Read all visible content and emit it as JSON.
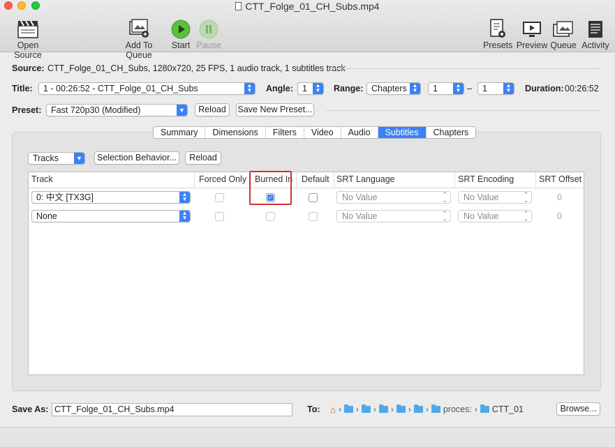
{
  "window": {
    "title": "CTT_Folge_01_CH_Subs.mp4"
  },
  "toolbar": {
    "open_source": "Open Source",
    "add_to_queue": "Add To Queue",
    "start": "Start",
    "pause": "Pause",
    "presets": "Presets",
    "preview": "Preview",
    "queue": "Queue",
    "activity": "Activity"
  },
  "source": {
    "label": "Source:",
    "value": "CTT_Folge_01_CH_Subs, 1280x720, 25 FPS, 1 audio track, 1 subtitles track"
  },
  "title_row": {
    "title_label": "Title:",
    "title_value": "1 - 00:26:52 - CTT_Folge_01_CH_Subs",
    "angle_label": "Angle:",
    "angle_value": "1",
    "range_label": "Range:",
    "range_type": "Chapters",
    "range_start": "1",
    "range_dash": "–",
    "range_end": "1",
    "duration_label": "Duration:",
    "duration_value": "00:26:52"
  },
  "preset_row": {
    "label": "Preset:",
    "value": "Fast 720p30 (Modified)",
    "reload": "Reload",
    "save_new": "Save New Preset..."
  },
  "tabs": [
    "Summary",
    "Dimensions",
    "Filters",
    "Video",
    "Audio",
    "Subtitles",
    "Chapters"
  ],
  "active_tab": "Subtitles",
  "subtitles": {
    "tracks_popup": "Tracks",
    "selection_behavior": "Selection Behavior...",
    "reload": "Reload",
    "columns": {
      "track": "Track",
      "forced_only": "Forced Only",
      "burned_in": "Burned In",
      "default": "Default",
      "srt_language": "SRT Language",
      "srt_encoding": "SRT Encoding",
      "srt_offset": "SRT Offset"
    },
    "rows": [
      {
        "track": "0: 中文 [TX3G]",
        "forced_only": false,
        "burned_in": true,
        "default": false,
        "srt_language": "No Value",
        "srt_encoding": "No Value",
        "srt_offset": "0"
      },
      {
        "track": "None",
        "forced_only": false,
        "burned_in": false,
        "default": false,
        "srt_language": "No Value",
        "srt_encoding": "No Value",
        "srt_offset": "0"
      }
    ]
  },
  "save": {
    "label": "Save As:",
    "filename": "CTT_Folge_01_CH_Subs.mp4",
    "to_label": "To:",
    "path_segment_1": "proces:",
    "path_segment_2": "CTT_01",
    "browse": "Browse..."
  },
  "colors": {
    "accent": "#3a82f7",
    "highlight_box": "#d0312d",
    "start_green": "#5bbf3b",
    "folder_blue": "#52a9e8"
  }
}
